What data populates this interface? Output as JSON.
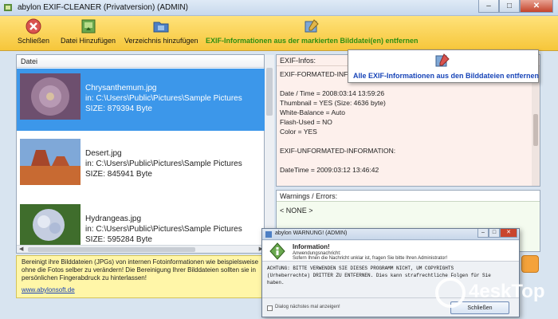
{
  "window": {
    "title": "abylon EXIF-CLEANER (Privatversion) (ADMIN)",
    "buttons": {
      "minimize": "–",
      "maximize": "□",
      "close": "✕"
    }
  },
  "toolbar": {
    "close_label": "Schließen",
    "add_file_label": "Datei Hinzufügen",
    "add_dir_label": "Verzeichnis hinzufügen",
    "remove_selected_label": "EXIF-Informationen aus der markierten Bilddatei(en) entfernen",
    "colors": {
      "accent_green": "#2f8f12",
      "bg": "#f6c63a"
    }
  },
  "filelist": {
    "header": "Datei",
    "items": [
      {
        "name": "Chrysanthemum.jpg",
        "path": "in: C:\\Users\\Public\\Pictures\\Sample Pictures",
        "size": "SIZE: 879394 Byte",
        "thumb": "chrysanthemum",
        "selected": true
      },
      {
        "name": "Desert.jpg",
        "path": "in: C:\\Users\\Public\\Pictures\\Sample Pictures",
        "size": "SIZE: 845941 Byte",
        "thumb": "desert",
        "selected": false
      },
      {
        "name": "Hydrangeas.jpg",
        "path": "in: C:\\Users\\Public\\Pictures\\Sample Pictures",
        "size": "SIZE: 595284 Byte",
        "thumb": "hydrangeas",
        "selected": false
      }
    ]
  },
  "info": {
    "text": "Bereinigt ihre Bilddateien (JPGs) von internen Fotoinformationen wie beispielsweise ohne die Fotos selber zu verändern! Die Bereinigung Ihrer Bilddateien sollten sie in persönlichen Fingerabdruck zu hinterlassen!",
    "link": "www.abylonsoft.de"
  },
  "exif": {
    "header": "EXIF-Infos:",
    "lines": [
      "EXIF-FORMATED-INFO",
      "",
      "Date / Time = 2008:03:14 13:59:26",
      "Thumbnail = YES (Size: 4636 byte)",
      "White-Balance = Auto",
      "Flash-Used = NO",
      "Color = YES",
      "",
      "EXIF-UNFORMATED-INFORMATION:",
      "",
      "DateTime = 2009:03:12 13:46:42"
    ]
  },
  "popup": {
    "label": "Alle EXIF-Informationen aus den Bilddateien entfernen"
  },
  "warnings": {
    "header": "Warnings / Errors:",
    "value": "< NONE >"
  },
  "dialog": {
    "title": "abylon WARNUNG! (ADMIN)",
    "heading": "Information!",
    "subheading_1": "Anwendungsnachricht:",
    "subheading_2": "Sofern Ihnen die Nachricht unklar ist, fragen Sie bitte Ihren Administrator!",
    "body_1": "ACHTUNG: BITTE VERWENDEN SIE DIESES PROGRAMM NICHT, UM COPYRIGHTS",
    "body_2": "(Urheberrechte) DRITTER ZU ENTFERNEN. Dies kann strafrechtliche Folgen für Sie",
    "body_3": "haben.",
    "checkbox_label": "Dialog nächstes mal anzeigen!",
    "ok_button": "Schließen"
  },
  "watermark": {
    "text": "4eskTop"
  }
}
